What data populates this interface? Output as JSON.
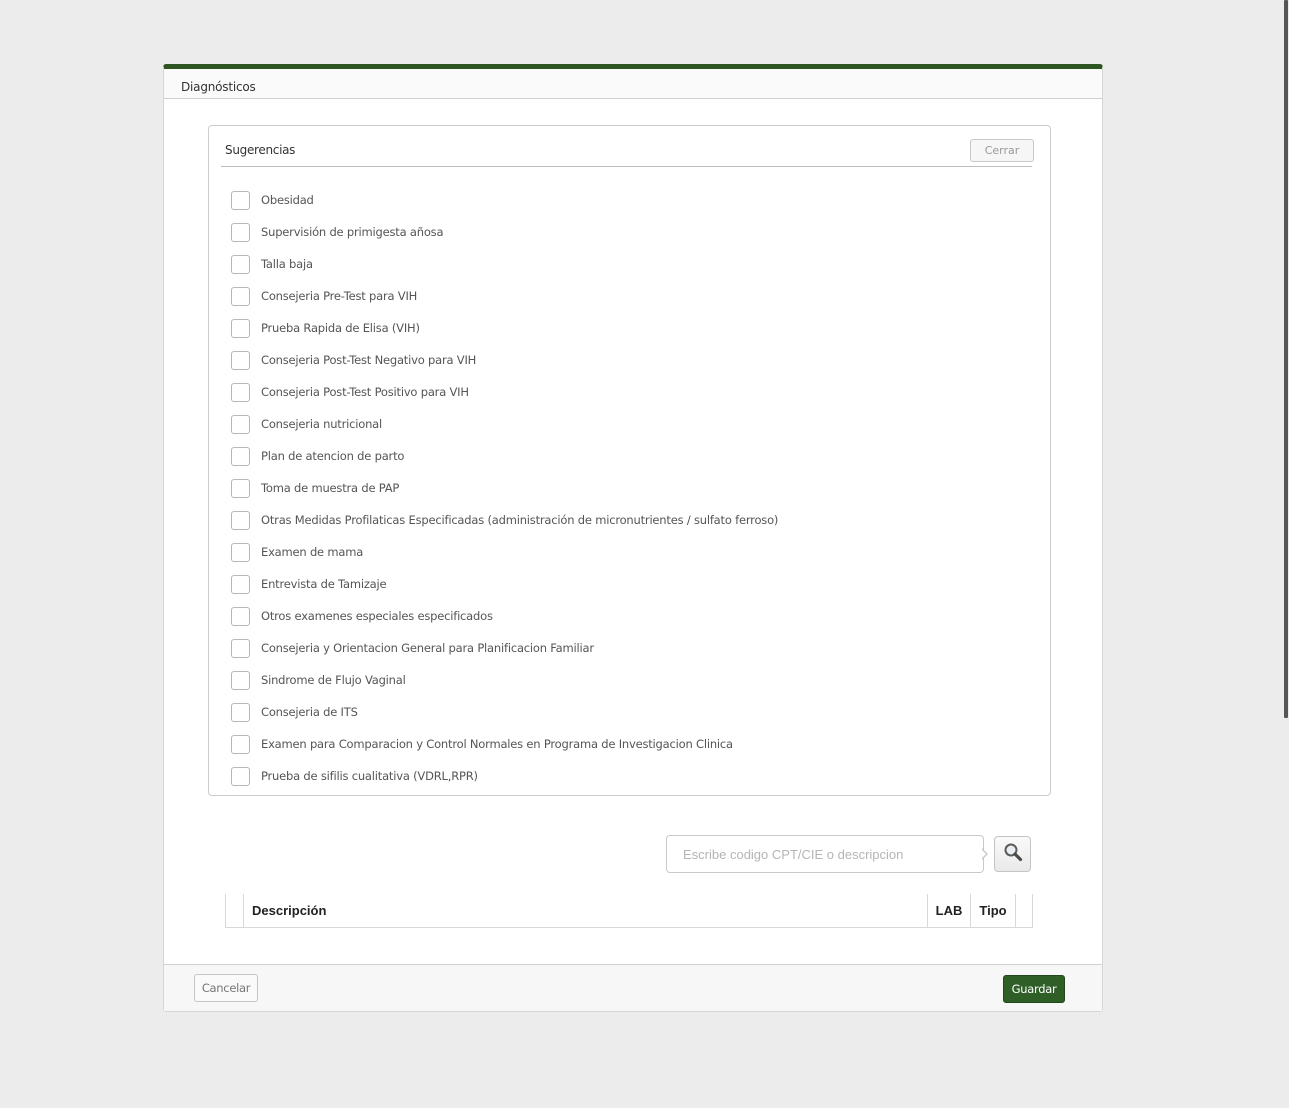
{
  "modal": {
    "title": "Diagnósticos"
  },
  "suggestions": {
    "title": "Sugerencias",
    "close_label": "Cerrar",
    "items": [
      {
        "label": "Obesidad",
        "checked": false
      },
      {
        "label": "Supervisión de primigesta añosa",
        "checked": false
      },
      {
        "label": "Talla baja",
        "checked": false
      },
      {
        "label": "Consejeria Pre-Test para VIH",
        "checked": false
      },
      {
        "label": "Prueba Rapida de Elisa (VIH)",
        "checked": false
      },
      {
        "label": "Consejeria Post-Test Negativo para VIH",
        "checked": false
      },
      {
        "label": "Consejeria Post-Test Positivo para VIH",
        "checked": false
      },
      {
        "label": "Consejeria nutricional",
        "checked": false
      },
      {
        "label": "Plan de atencion de parto",
        "checked": false
      },
      {
        "label": "Toma de muestra de PAP",
        "checked": false
      },
      {
        "label": "Otras Medidas Profilaticas Especificadas (administración de micronutrientes / sulfato ferroso)",
        "checked": false
      },
      {
        "label": "Examen de mama",
        "checked": false
      },
      {
        "label": "Entrevista de Tamizaje",
        "checked": false
      },
      {
        "label": "Otros examenes especiales especificados",
        "checked": false
      },
      {
        "label": "Consejeria y Orientacion General para Planificacion Familiar",
        "checked": false
      },
      {
        "label": "Sindrome de Flujo Vaginal",
        "checked": false
      },
      {
        "label": "Consejeria de ITS",
        "checked": false
      },
      {
        "label": "Examen para Comparacion y Control Normales en Programa de Investigacion Clinica",
        "checked": false
      },
      {
        "label": "Prueba de sifilis cualitativa (VDRL,RPR)",
        "checked": false
      }
    ]
  },
  "search": {
    "placeholder": "Escribe codigo CPT/CIE o descripcion",
    "value": "",
    "icon": "magnifier-icon"
  },
  "table": {
    "columns": [
      "",
      "Descripción",
      "LAB",
      "Tipo",
      ""
    ],
    "rows": []
  },
  "footer": {
    "cancel_label": "Cancelar",
    "save_label": "Guardar"
  },
  "colors": {
    "accent": "#2c5522",
    "save_button": "#2f5e27",
    "background": "#ececec"
  }
}
